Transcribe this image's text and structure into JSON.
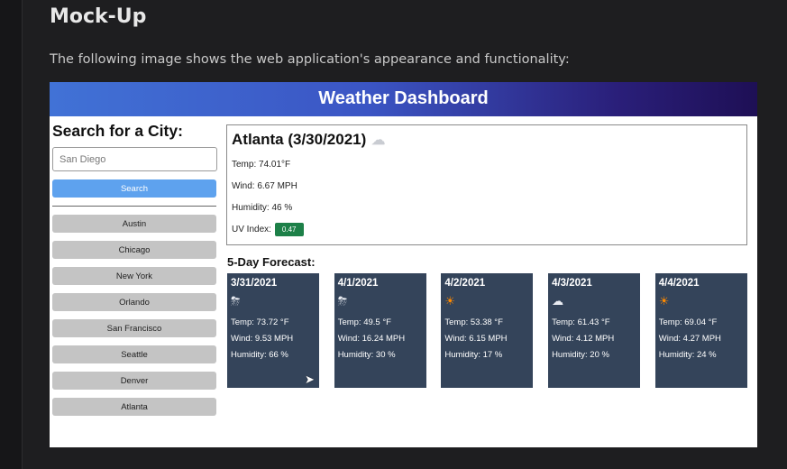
{
  "doc": {
    "heading": "Mock-Up",
    "description": "The following image shows the web application's appearance and functionality:"
  },
  "app": {
    "title": "Weather Dashboard",
    "search": {
      "title": "Search for a City:",
      "placeholder": "San Diego",
      "button_label": "Search"
    },
    "history": [
      "Austin",
      "Chicago",
      "New York",
      "Orlando",
      "San Francisco",
      "Seattle",
      "Denver",
      "Atlanta"
    ],
    "current": {
      "heading": "Atlanta (3/30/2021)",
      "icon": "cloud-icon",
      "temp": "Temp: 74.01°F",
      "wind": "Wind: 6.67 MPH",
      "humidity": "Humidity: 46 %",
      "uv_label": "UV Index:",
      "uv_value": "0.47",
      "uv_color": "#1d8048"
    },
    "forecast": {
      "title": "5-Day Forecast:",
      "days": [
        {
          "date": "3/31/2021",
          "icon": "rain-sun-icon",
          "glyph": "⛈",
          "temp": "Temp: 73.72 °F",
          "wind": "Wind: 9.53 MPH",
          "humidity": "Humidity: 66 %"
        },
        {
          "date": "4/1/2021",
          "icon": "rain-sun-icon",
          "glyph": "⛈",
          "temp": "Temp: 49.5 °F",
          "wind": "Wind: 16.24 MPH",
          "humidity": "Humidity: 30 %"
        },
        {
          "date": "4/2/2021",
          "icon": "sun-icon",
          "glyph": "☀",
          "temp": "Temp: 53.38 °F",
          "wind": "Wind: 6.15 MPH",
          "humidity": "Humidity: 17 %"
        },
        {
          "date": "4/3/2021",
          "icon": "cloud-icon",
          "glyph": "☁",
          "temp": "Temp: 61.43 °F",
          "wind": "Wind: 4.12 MPH",
          "humidity": "Humidity: 20 %"
        },
        {
          "date": "4/4/2021",
          "icon": "sun-icon",
          "glyph": "☀",
          "temp": "Temp: 69.04 °F",
          "wind": "Wind: 4.27 MPH",
          "humidity": "Humidity: 24 %"
        }
      ]
    },
    "colors": {
      "search_button": "#5ea2ee",
      "history_button": "#c4c4c4",
      "card_bg": "#34445a"
    }
  }
}
